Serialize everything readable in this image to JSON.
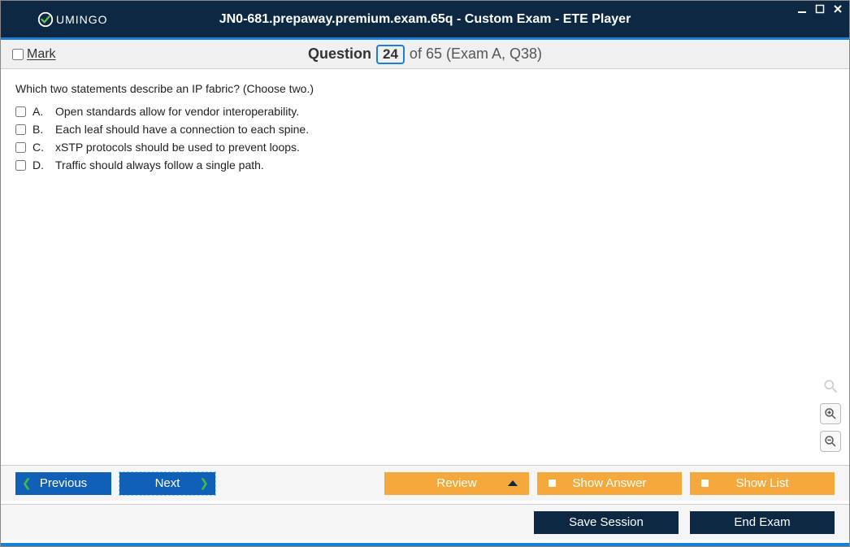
{
  "brand": "UMINGO",
  "title": "JN0-681.prepaway.premium.exam.65q - Custom Exam - ETE Player",
  "mark_label": "Mark",
  "question": {
    "word": "Question",
    "number": "24",
    "of_text": "of 65 (Exam A, Q38)",
    "text": "Which two statements describe an IP fabric? (Choose two.)",
    "answers": [
      {
        "letter": "A.",
        "text": "Open standards allow for vendor interoperability."
      },
      {
        "letter": "B.",
        "text": "Each leaf should have a connection to each spine."
      },
      {
        "letter": "C.",
        "text": "xSTP protocols should be used to prevent loops."
      },
      {
        "letter": "D.",
        "text": "Traffic should always follow a single path."
      }
    ]
  },
  "buttons": {
    "previous": "Previous",
    "next": "Next",
    "review": "Review",
    "show_answer": "Show Answer",
    "show_list": "Show List",
    "save_session": "Save Session",
    "end_exam": "End Exam"
  }
}
